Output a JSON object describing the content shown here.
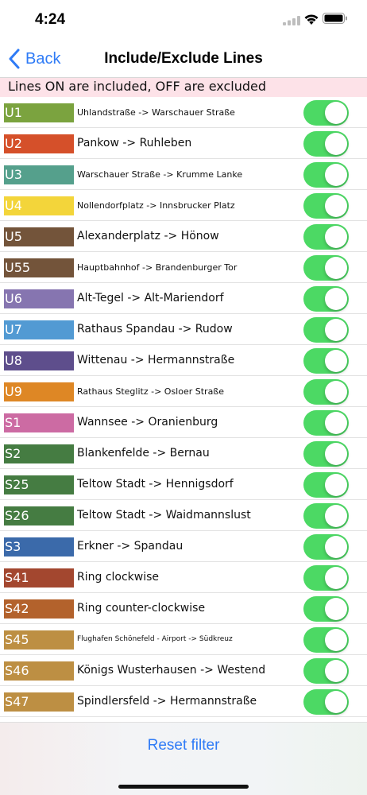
{
  "status": {
    "time": "4:24"
  },
  "nav": {
    "back_label": "Back",
    "title": "Include/Exclude Lines"
  },
  "banner": {
    "text": "Lines ON are included, OFF are excluded"
  },
  "toggle_color": "#4cd964",
  "lines": [
    {
      "code": "U1",
      "route": "Uhlandstraße -> Warschauer Straße",
      "color": "#7ba33f",
      "size": "small",
      "enabled": true
    },
    {
      "code": "U2",
      "route": "Pankow -> Ruhleben",
      "color": "#d5502a",
      "size": "normal",
      "enabled": true
    },
    {
      "code": "U3",
      "route": "Warschauer Straße -> Krumme Lanke",
      "color": "#55a08c",
      "size": "small",
      "enabled": true
    },
    {
      "code": "U4",
      "route": "Nollendorfplatz -> Innsbrucker Platz",
      "color": "#f3d53a",
      "size": "small",
      "enabled": true
    },
    {
      "code": "U5",
      "route": "Alexanderplatz -> Hönow",
      "color": "#73543a",
      "size": "normal",
      "enabled": true
    },
    {
      "code": "U55",
      "route": "Hauptbahnhof -> Brandenburger Tor",
      "color": "#73543a",
      "size": "small",
      "enabled": true
    },
    {
      "code": "U6",
      "route": "Alt-Tegel -> Alt-Mariendorf",
      "color": "#8675b0",
      "size": "normal",
      "enabled": true
    },
    {
      "code": "U7",
      "route": "Rathaus Spandau -> Rudow",
      "color": "#529ad3",
      "size": "normal",
      "enabled": true
    },
    {
      "code": "U8",
      "route": "Wittenau -> Hermannstraße",
      "color": "#5e4e8c",
      "size": "normal",
      "enabled": true
    },
    {
      "code": "U9",
      "route": "Rathaus Steglitz -> Osloer Straße",
      "color": "#de8725",
      "size": "small",
      "enabled": true
    },
    {
      "code": "S1",
      "route": "Wannsee -> Oranienburg",
      "color": "#cc6ba3",
      "size": "normal",
      "enabled": true
    },
    {
      "code": "S2",
      "route": "Blankenfelde -> Bernau",
      "color": "#457c42",
      "size": "normal",
      "enabled": true
    },
    {
      "code": "S25",
      "route": "Teltow Stadt -> Hennigsdorf",
      "color": "#457c42",
      "size": "normal",
      "enabled": true
    },
    {
      "code": "S26",
      "route": "Teltow Stadt -> Waidmannslust",
      "color": "#457c42",
      "size": "normal",
      "enabled": true
    },
    {
      "code": "S3",
      "route": "Erkner -> Spandau",
      "color": "#3b6aaa",
      "size": "normal",
      "enabled": true
    },
    {
      "code": "S41",
      "route": "Ring clockwise",
      "color": "#a3472f",
      "size": "normal",
      "enabled": true
    },
    {
      "code": "S42",
      "route": "Ring counter-clockwise",
      "color": "#b3622c",
      "size": "normal",
      "enabled": true
    },
    {
      "code": "S45",
      "route": "Flughafen Schönefeld - Airport -> Südkreuz",
      "color": "#bd8f43",
      "size": "tiny",
      "enabled": true
    },
    {
      "code": "S46",
      "route": "Königs Wusterhausen -> Westend",
      "color": "#bd8f43",
      "size": "normal",
      "enabled": true
    },
    {
      "code": "S47",
      "route": "Spindlersfeld -> Hermannstraße",
      "color": "#bd8f43",
      "size": "normal",
      "enabled": true
    }
  ],
  "footer": {
    "reset_label": "Reset filter"
  }
}
